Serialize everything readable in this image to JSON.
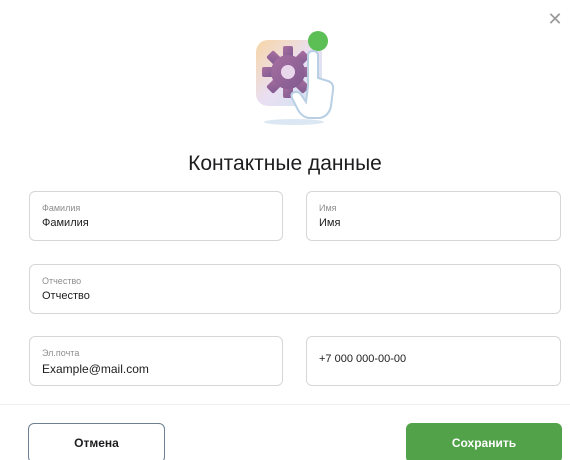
{
  "dialog": {
    "title": "Контактные данные",
    "close_icon": "close-icon"
  },
  "fields": {
    "last_name": {
      "label": "Фамилия",
      "value": "Фамилия"
    },
    "first_name": {
      "label": "Имя",
      "value": "Имя"
    },
    "middle_name": {
      "label": "Отчество",
      "value": "Отчество"
    },
    "email": {
      "label": "Эл.почта",
      "value": "Example@mail.com"
    },
    "phone": {
      "value": "+7 000 000-00-00"
    }
  },
  "footer": {
    "cancel_label": "Отмена",
    "save_label": "Сохранить"
  },
  "colors": {
    "accent": "#52a24a",
    "cancel_border": "#6d7f91"
  }
}
